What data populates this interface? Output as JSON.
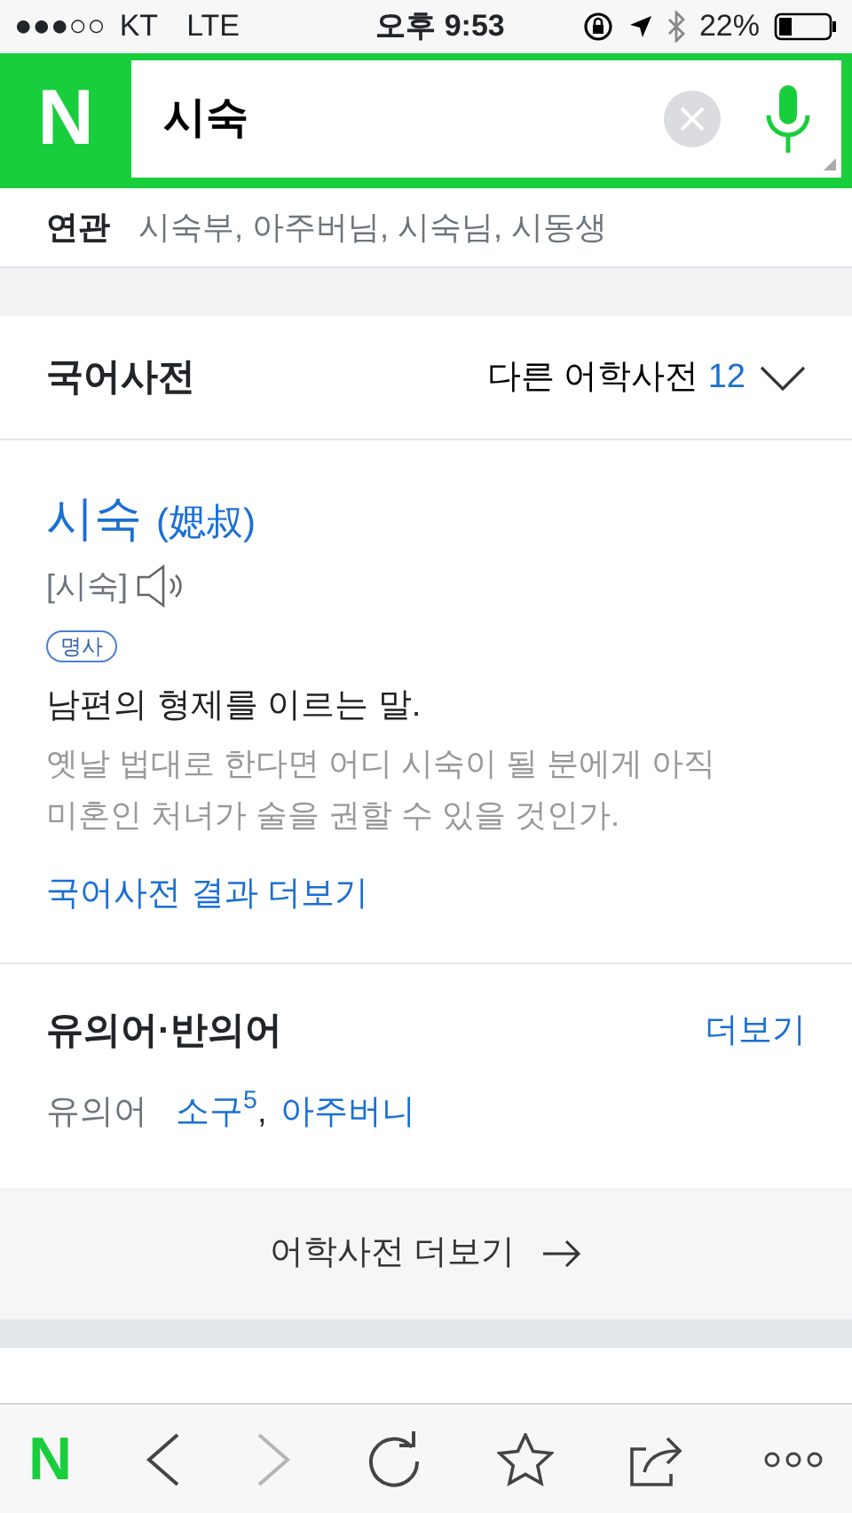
{
  "status_bar": {
    "signal": "●●●○○",
    "carrier": "KT",
    "network": "LTE",
    "time": "오후 9:53",
    "battery": "22%"
  },
  "search": {
    "logo": "N",
    "value": "시숙"
  },
  "related": {
    "label": "연관",
    "terms": "시숙부, 아주버님, 시숙님, 시동생"
  },
  "dictionary": {
    "title": "국어사전",
    "other_label": "다른 어학사전",
    "other_count": "12",
    "entry": {
      "word": "시숙",
      "hanja": "(媤叔)",
      "pronunciation": "[시숙]",
      "pos": "명사",
      "definition": "남편의 형제를 이르는 말.",
      "example": "옛날 법대로 한다면 어디 시숙이 될 분에게 아직 미혼인 처녀가 술을 권할 수 있을 것인가."
    },
    "more_link": "국어사전 결과 더보기"
  },
  "synonyms": {
    "title": "유의어·반의어",
    "more": "더보기",
    "label": "유의어",
    "separator": ",",
    "terms": [
      {
        "text": "소구$^{5}$"
      },
      {
        "text": "아주버니"
      }
    ]
  },
  "more_dictionaries": "어학사전 더보기",
  "toolbar": [
    {
      "kind": "logo",
      "text": "N",
      "disabled": false
    },
    {
      "kind": "back",
      "disabled": false
    },
    {
      "kind": "forward",
      "disabled": true
    },
    {
      "kind": "reload",
      "disabled": false
    },
    {
      "kind": "bookmark",
      "disabled": false
    },
    {
      "kind": "share",
      "disabled": false
    },
    {
      "kind": "more",
      "disabled": false
    }
  ]
}
